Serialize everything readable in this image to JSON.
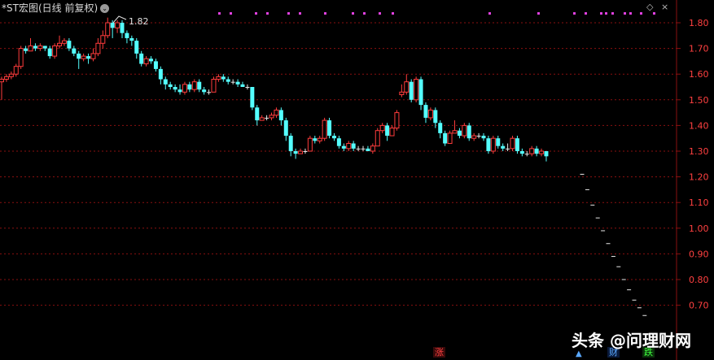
{
  "header": {
    "title": "*ST宏图(日线 前复权)",
    "peak_label": "1.82"
  },
  "axis": {
    "min": 0.65,
    "max": 1.85,
    "ticks": [
      "1.80",
      "1.70",
      "1.60",
      "1.50",
      "1.40",
      "1.30",
      "1.20",
      "1.10",
      "1.00",
      "0.90",
      "0.80",
      "0.70"
    ]
  },
  "markers": {
    "zhang": "涨",
    "cai": "财",
    "die": "跌",
    "tri": "▲"
  },
  "watermark": "头条 @问理财网",
  "icons": {
    "diamond": "◇",
    "close": "×"
  },
  "colors": {
    "up": "#ff3c3c",
    "down": "#54ffff",
    "flat": "#e8e8e8",
    "grid": "#8a1010",
    "axis_text": "#ff4040",
    "event_dot": "#e040e0"
  },
  "chart_data": {
    "type": "candlestick",
    "candles": [
      [
        1.57,
        1.58,
        1.5,
        1.59
      ],
      [
        1.58,
        1.59,
        1.57,
        1.6
      ],
      [
        1.59,
        1.6,
        1.58,
        1.61
      ],
      [
        1.6,
        1.63,
        1.59,
        1.64
      ],
      [
        1.63,
        1.7,
        1.62,
        1.71
      ],
      [
        1.7,
        1.69,
        1.68,
        1.71
      ],
      [
        1.69,
        1.71,
        1.69,
        1.74
      ],
      [
        1.71,
        1.7,
        1.69,
        1.72
      ],
      [
        1.7,
        1.71,
        1.69,
        1.72
      ],
      [
        1.71,
        1.7,
        1.69,
        1.71
      ],
      [
        1.7,
        1.67,
        1.66,
        1.71
      ],
      [
        1.67,
        1.71,
        1.66,
        1.72
      ],
      [
        1.71,
        1.72,
        1.7,
        1.75
      ],
      [
        1.72,
        1.73,
        1.71,
        1.74
      ],
      [
        1.73,
        1.7,
        1.69,
        1.74
      ],
      [
        1.7,
        1.68,
        1.67,
        1.71
      ],
      [
        1.68,
        1.66,
        1.62,
        1.69
      ],
      [
        1.66,
        1.67,
        1.65,
        1.68
      ],
      [
        1.67,
        1.66,
        1.64,
        1.68
      ],
      [
        1.66,
        1.68,
        1.65,
        1.7
      ],
      [
        1.68,
        1.72,
        1.67,
        1.74
      ],
      [
        1.72,
        1.75,
        1.7,
        1.77
      ],
      [
        1.75,
        1.8,
        1.74,
        1.82
      ],
      [
        1.8,
        1.78,
        1.74,
        1.81
      ],
      [
        1.78,
        1.8,
        1.76,
        1.81
      ],
      [
        1.8,
        1.76,
        1.74,
        1.81
      ],
      [
        1.76,
        1.74,
        1.72,
        1.77
      ],
      [
        1.74,
        1.73,
        1.71,
        1.75
      ],
      [
        1.73,
        1.68,
        1.66,
        1.74
      ],
      [
        1.68,
        1.64,
        1.63,
        1.69
      ],
      [
        1.64,
        1.66,
        1.63,
        1.67
      ],
      [
        1.66,
        1.65,
        1.64,
        1.67
      ],
      [
        1.65,
        1.62,
        1.61,
        1.66
      ],
      [
        1.62,
        1.58,
        1.56,
        1.63
      ],
      [
        1.58,
        1.56,
        1.54,
        1.59
      ],
      [
        1.56,
        1.55,
        1.54,
        1.57
      ],
      [
        1.55,
        1.54,
        1.53,
        1.56
      ],
      [
        1.54,
        1.53,
        1.52,
        1.56
      ],
      [
        1.53,
        1.56,
        1.52,
        1.57
      ],
      [
        1.56,
        1.54,
        1.53,
        1.57
      ],
      [
        1.54,
        1.57,
        1.53,
        1.58
      ],
      [
        1.57,
        1.54,
        1.53,
        1.58
      ],
      [
        1.54,
        1.53,
        1.52,
        1.55
      ],
      [
        1.53,
        1.53,
        1.52,
        1.54
      ],
      [
        1.53,
        1.58,
        1.53,
        1.59
      ],
      [
        1.58,
        1.59,
        1.57,
        1.6
      ],
      [
        1.59,
        1.58,
        1.57,
        1.6
      ],
      [
        1.58,
        1.57,
        1.56,
        1.59
      ],
      [
        1.57,
        1.57,
        1.56,
        1.58
      ],
      [
        1.57,
        1.56,
        1.55,
        1.58
      ],
      [
        1.56,
        1.55,
        1.55,
        1.57
      ],
      [
        1.55,
        1.55,
        1.54,
        1.56
      ],
      [
        1.55,
        1.47,
        1.46,
        1.55
      ],
      [
        1.47,
        1.42,
        1.4,
        1.48
      ],
      [
        1.42,
        1.43,
        1.42,
        1.44
      ],
      [
        1.43,
        1.43,
        1.42,
        1.44
      ],
      [
        1.43,
        1.44,
        1.42,
        1.45
      ],
      [
        1.44,
        1.46,
        1.43,
        1.47
      ],
      [
        1.46,
        1.42,
        1.4,
        1.47
      ],
      [
        1.42,
        1.36,
        1.34,
        1.43
      ],
      [
        1.36,
        1.3,
        1.28,
        1.37
      ],
      [
        1.3,
        1.29,
        1.27,
        1.31
      ],
      [
        1.29,
        1.3,
        1.29,
        1.31
      ],
      [
        1.3,
        1.3,
        1.29,
        1.31
      ],
      [
        1.3,
        1.35,
        1.3,
        1.36
      ],
      [
        1.35,
        1.34,
        1.33,
        1.36
      ],
      [
        1.34,
        1.35,
        1.33,
        1.36
      ],
      [
        1.35,
        1.42,
        1.34,
        1.43
      ],
      [
        1.42,
        1.36,
        1.35,
        1.43
      ],
      [
        1.36,
        1.35,
        1.34,
        1.37
      ],
      [
        1.35,
        1.32,
        1.31,
        1.36
      ],
      [
        1.32,
        1.31,
        1.3,
        1.33
      ],
      [
        1.31,
        1.33,
        1.3,
        1.34
      ],
      [
        1.33,
        1.31,
        1.3,
        1.34
      ],
      [
        1.31,
        1.31,
        1.3,
        1.32
      ],
      [
        1.31,
        1.31,
        1.3,
        1.32
      ],
      [
        1.31,
        1.3,
        1.3,
        1.32
      ],
      [
        1.3,
        1.32,
        1.29,
        1.33
      ],
      [
        1.32,
        1.38,
        1.32,
        1.39
      ],
      [
        1.38,
        1.4,
        1.37,
        1.41
      ],
      [
        1.4,
        1.36,
        1.34,
        1.41
      ],
      [
        1.36,
        1.39,
        1.36,
        1.4
      ],
      [
        1.39,
        1.45,
        1.38,
        1.46
      ],
      [
        1.52,
        1.53,
        1.51,
        1.56
      ],
      [
        1.53,
        1.57,
        1.52,
        1.6
      ],
      [
        1.57,
        1.5,
        1.49,
        1.58
      ],
      [
        1.5,
        1.58,
        1.49,
        1.59
      ],
      [
        1.58,
        1.48,
        1.46,
        1.59
      ],
      [
        1.48,
        1.43,
        1.41,
        1.49
      ],
      [
        1.43,
        1.46,
        1.42,
        1.47
      ],
      [
        1.46,
        1.41,
        1.39,
        1.47
      ],
      [
        1.41,
        1.37,
        1.35,
        1.42
      ],
      [
        1.37,
        1.33,
        1.32,
        1.38
      ],
      [
        1.33,
        1.37,
        1.33,
        1.38
      ],
      [
        1.37,
        1.38,
        1.37,
        1.42
      ],
      [
        1.38,
        1.36,
        1.35,
        1.39
      ],
      [
        1.36,
        1.4,
        1.35,
        1.41
      ],
      [
        1.4,
        1.35,
        1.34,
        1.41
      ],
      [
        1.35,
        1.36,
        1.34,
        1.37
      ],
      [
        1.36,
        1.36,
        1.35,
        1.37
      ],
      [
        1.36,
        1.35,
        1.34,
        1.37
      ],
      [
        1.35,
        1.3,
        1.29,
        1.36
      ],
      [
        1.3,
        1.35,
        1.29,
        1.36
      ],
      [
        1.35,
        1.32,
        1.31,
        1.36
      ],
      [
        1.32,
        1.31,
        1.3,
        1.33
      ],
      [
        1.31,
        1.31,
        1.3,
        1.33
      ],
      [
        1.31,
        1.35,
        1.3,
        1.36
      ],
      [
        1.35,
        1.3,
        1.29,
        1.36
      ],
      [
        1.3,
        1.29,
        1.28,
        1.31
      ],
      [
        1.29,
        1.29,
        1.28,
        1.3
      ],
      [
        1.29,
        1.31,
        1.28,
        1.32
      ],
      [
        1.31,
        1.29,
        1.28,
        1.32
      ],
      [
        1.29,
        1.3,
        1.28,
        1.31
      ],
      [
        1.3,
        1.28,
        1.26,
        1.3
      ]
    ],
    "limit_down_dashes": [
      1.21,
      1.15,
      1.09,
      1.04,
      0.99,
      0.94,
      0.89,
      0.85,
      0.8,
      0.76,
      0.72,
      0.69,
      0.66
    ]
  }
}
